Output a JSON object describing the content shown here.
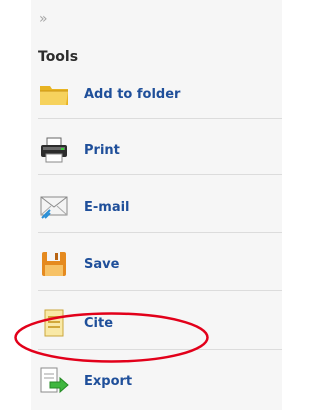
{
  "panel": {
    "collapse_glyph": "»",
    "title": "Tools",
    "items": [
      {
        "id": "add-to-folder",
        "label": "Add to folder",
        "icon": "folder-icon"
      },
      {
        "id": "print",
        "label": "Print",
        "icon": "printer-icon"
      },
      {
        "id": "email",
        "label": "E-mail",
        "icon": "envelope-icon"
      },
      {
        "id": "save",
        "label": "Save",
        "icon": "floppy-disk-icon"
      },
      {
        "id": "cite",
        "label": "Cite",
        "icon": "document-icon"
      },
      {
        "id": "export",
        "label": "Export",
        "icon": "export-arrow-icon"
      }
    ]
  },
  "annotation": {
    "color": "#e2001a",
    "highlighted_item": "Cite"
  },
  "colors": {
    "label": "#1f4f9a",
    "panel_bg": "#f6f6f6"
  }
}
